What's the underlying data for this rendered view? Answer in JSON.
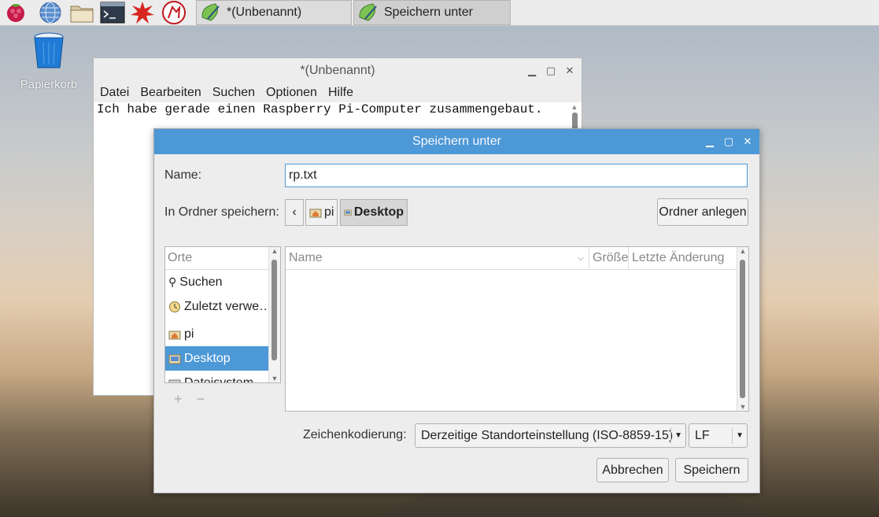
{
  "taskbar": {
    "tasks": [
      {
        "label": "*(Unbenannt)"
      },
      {
        "label": "Speichern unter"
      }
    ]
  },
  "desktop": {
    "trash_label": "Papierkorb"
  },
  "editor": {
    "title": "*(Unbenannt)",
    "menu": [
      "Datei",
      "Bearbeiten",
      "Suchen",
      "Optionen",
      "Hilfe"
    ],
    "text": "Ich habe gerade einen Raspberry Pi-Computer zusammengebaut."
  },
  "dialog": {
    "title": "Speichern unter",
    "name_label": "Name:",
    "name_value": "rp.txt",
    "folder_label": "In Ordner speichern:",
    "breadcrumbs": [
      {
        "label": "pi",
        "icon": "home-folder-icon"
      },
      {
        "label": "Desktop",
        "icon": "desktop-icon"
      }
    ],
    "create_folder": "Ordner anlegen",
    "places_header": "Orte",
    "places": [
      {
        "label": "Suchen",
        "icon": "search-icon"
      },
      {
        "label": "Zuletzt verwe…",
        "icon": "recent-icon"
      },
      {
        "label": "pi",
        "icon": "home-folder-icon"
      },
      {
        "label": "Desktop",
        "icon": "desktop-icon",
        "selected": true
      },
      {
        "label": "Dateisystem",
        "icon": "drive-icon"
      }
    ],
    "columns": {
      "name": "Name",
      "size": "Größe",
      "modified": "Letzte Änderung"
    },
    "encoding_label": "Zeichenkodierung:",
    "encoding_value": "Derzeitige Standorteinstellung (ISO-8859-15)",
    "lineend_value": "LF",
    "cancel": "Abbrechen",
    "save": "Speichern"
  },
  "colors": {
    "accent": "#4d98d6",
    "taskbar": "#ececec"
  }
}
